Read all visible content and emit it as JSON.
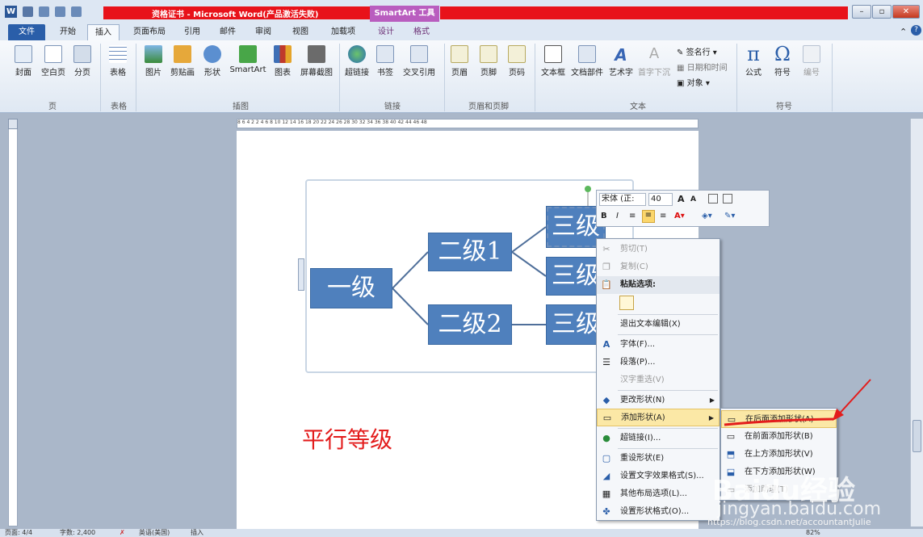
{
  "window": {
    "title": "资格证书 - Microsoft Word(产品激活失败)",
    "contextual_tab": "SmartArt 工具",
    "app_icon": "W"
  },
  "tabs": [
    "文件",
    "开始",
    "插入",
    "页面布局",
    "引用",
    "邮件",
    "审阅",
    "视图",
    "加载项",
    "设计",
    "格式"
  ],
  "ribbon": {
    "buttons": [
      "封面",
      "空白页",
      "分页",
      "表格",
      "图片",
      "剪贴画",
      "形状",
      "SmartArt",
      "图表",
      "屏幕截图",
      "超链接",
      "书签",
      "交叉引用",
      "页眉",
      "页脚",
      "页码",
      "文本框",
      "文档部件",
      "艺术字",
      "首字下沉",
      "公式",
      "符号",
      "编号"
    ],
    "small": [
      "签名行",
      "日期和时间",
      "对象"
    ],
    "groups": [
      "页",
      "表格",
      "插图",
      "链接",
      "页眉和页脚",
      "文本",
      "符号"
    ]
  },
  "ruler": "8 6 4 2  2 4 6 8 10 12 14 16 18 20 22 24 26 28 30 32 34 36 38 40 42 44 46 48",
  "smartart": {
    "level1": "一级",
    "level2a": "二级1",
    "level2b": "二级2",
    "level3a": "三级1",
    "level3b": "三级",
    "level3c": "三级"
  },
  "caption": "平行等级",
  "minitoolbar": {
    "font": "宋体 (正:",
    "size": "40"
  },
  "context_menu": [
    "剪切(T)",
    "复制(C)",
    "粘贴选项:",
    "退出文本编辑(X)",
    "字体(F)...",
    "段落(P)...",
    "汉字重选(V)",
    "更改形状(N)",
    "添加形状(A)",
    "超链接(I)...",
    "重设形状(E)",
    "设置文字效果格式(S)...",
    "其他布局选项(L)...",
    "设置形状格式(O)..."
  ],
  "submenu": [
    "在后面添加形状(A)",
    "在前面添加形状(B)",
    "在上方添加形状(V)",
    "在下方添加形状(W)",
    "添加助理(T)"
  ],
  "status": {
    "page": "页面: 4/4",
    "words": "字数: 2,400",
    "lang": "英语(美国)",
    "mode": "插入",
    "zoom": "82%"
  },
  "watermark": {
    "main": "Baidu经验",
    "url": "jingyan.baidu.com",
    "blog": "https://blog.csdn.net/accountantJulie"
  },
  "colors": {
    "accent": "#2a5ea9",
    "shape": "#4f80bd",
    "highlight": "#e31c1c"
  }
}
